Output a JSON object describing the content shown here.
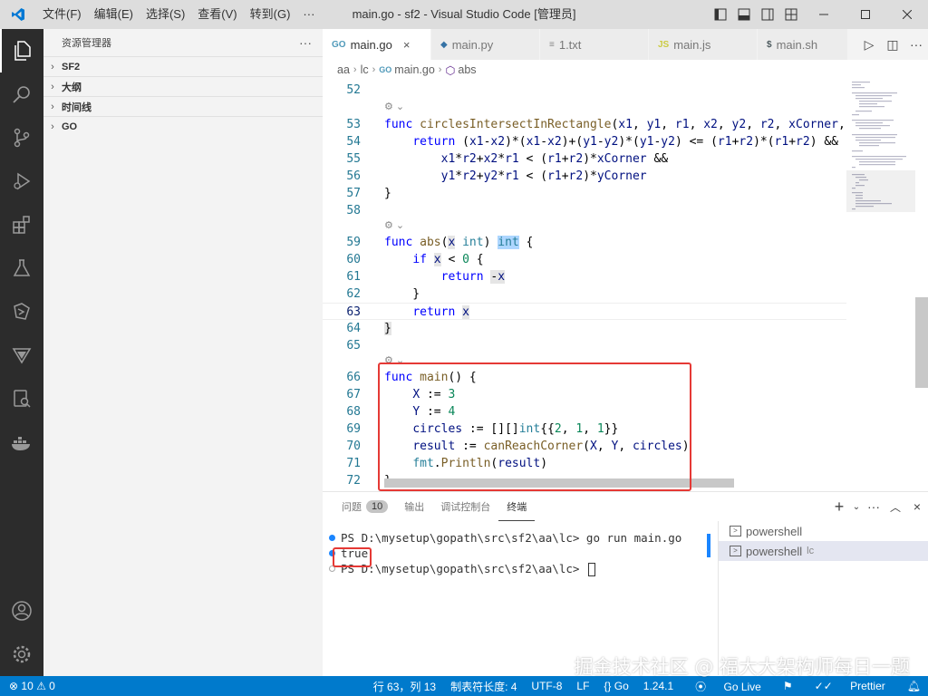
{
  "window": {
    "title": "main.go - sf2 - Visual Studio Code [管理员]",
    "menu": [
      "文件(F)",
      "编辑(E)",
      "选择(S)",
      "查看(V)",
      "转到(G)",
      "···"
    ]
  },
  "sidebar": {
    "title": "资源管理器",
    "more": "···",
    "sections": [
      "SF2",
      "大纲",
      "时间线",
      "GO"
    ]
  },
  "tabs": [
    {
      "icon": "GO",
      "label": "main.go",
      "active": true,
      "close": "×"
    },
    {
      "icon": "py",
      "label": "main.py",
      "active": false
    },
    {
      "icon": "≡",
      "label": "1.txt",
      "active": false
    },
    {
      "icon": "JS",
      "label": "main.js",
      "active": false
    },
    {
      "icon": "$",
      "label": "main.sh",
      "active": false
    }
  ],
  "breadcrumb": [
    "aa",
    "lc",
    "main.go",
    "abs"
  ],
  "code": {
    "l52": "52",
    "l53": "53",
    "l54": "54",
    "l55": "55",
    "l56": "56",
    "l57": "57",
    "l58": "58",
    "l59": "59",
    "l60": "60",
    "l61": "61",
    "l62": "62",
    "l63": "63",
    "l64": "64",
    "l65": "65",
    "l66": "66",
    "l67": "67",
    "l68": "68",
    "l69": "69",
    "l70": "70",
    "l71": "71",
    "l72": "72",
    "codelens": "⚙ ⌄"
  },
  "panel": {
    "tabs": [
      "问题",
      "输出",
      "调试控制台",
      "终端"
    ],
    "problems_count": "10",
    "terminal_lines": [
      "PS D:\\mysetup\\gopath\\src\\sf2\\aa\\lc> go run main.go",
      "true",
      "PS D:\\mysetup\\gopath\\src\\sf2\\aa\\lc> "
    ],
    "terminals": [
      {
        "label": "powershell",
        "sub": ""
      },
      {
        "label": "powershell",
        "sub": "lc"
      }
    ]
  },
  "statusbar": {
    "errors": "⊗ 10 ⚠ 0",
    "position": "行 63，列 13",
    "tabsize": "制表符长度: 4",
    "encoding": "UTF-8",
    "eol": "LF",
    "language": "{} Go",
    "version": "1.24.1",
    "golive": "Go Live",
    "prettier": "Prettier"
  },
  "watermark": "掘金技术社区 @ 福大大架构师每日一题",
  "colors": {
    "accent": "#007acc",
    "activitybar": "#2c2c2c",
    "annotation": "#e53935"
  }
}
